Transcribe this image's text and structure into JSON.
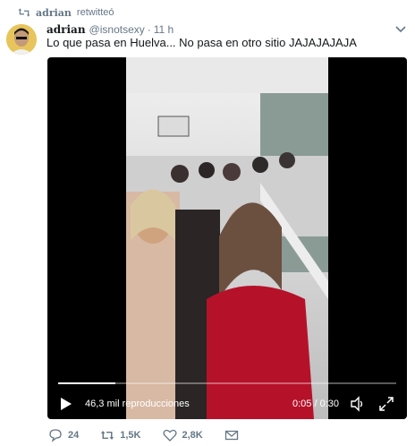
{
  "retweet": {
    "user": "adrian",
    "label": "retwitteó"
  },
  "tweet": {
    "name": "adrian",
    "handle": "@isnotsexy",
    "separator": "·",
    "time": "11 h",
    "text": "Lo que pasa en Huelva... No pasa en otro sitio JAJAJAJAJA"
  },
  "video": {
    "views": "46,3 mil reproducciones",
    "time": "0:05 / 0:30",
    "progress_fraction": 0.17
  },
  "actions": {
    "replies": "24",
    "retweets": "1,5K",
    "likes": "2,8K"
  },
  "icons": {
    "retweet_small": "retweet-icon",
    "caret": "chevron-down-icon",
    "play": "play-icon",
    "volume": "volume-icon",
    "fullscreen": "fullscreen-icon",
    "reply": "reply-icon",
    "retweet": "retweet-icon",
    "like": "heart-icon",
    "dm": "envelope-icon"
  },
  "colors": {
    "muted": "#657786",
    "text": "#14171a",
    "media_bg": "#000000"
  }
}
